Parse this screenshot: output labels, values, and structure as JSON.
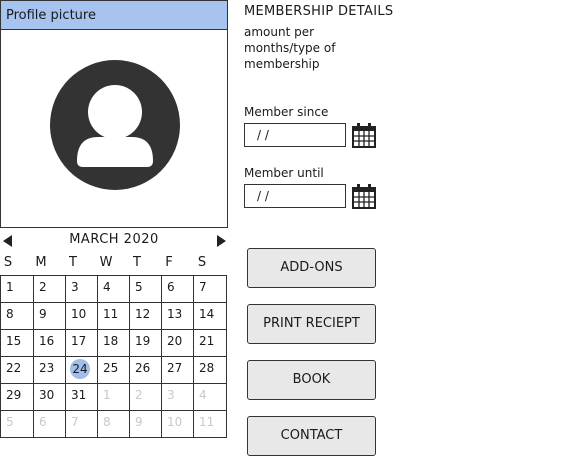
{
  "profile": {
    "title": "Profile picture"
  },
  "calendar": {
    "month_label": "MARCH 2020",
    "weekdays": [
      "S",
      "M",
      "T",
      "W",
      "T",
      "F",
      "S"
    ],
    "weeks": [
      [
        {
          "d": "1"
        },
        {
          "d": "2"
        },
        {
          "d": "3"
        },
        {
          "d": "4"
        },
        {
          "d": "5"
        },
        {
          "d": "6"
        },
        {
          "d": "7"
        }
      ],
      [
        {
          "d": "8"
        },
        {
          "d": "9"
        },
        {
          "d": "10"
        },
        {
          "d": "11"
        },
        {
          "d": "12"
        },
        {
          "d": "13"
        },
        {
          "d": "14"
        }
      ],
      [
        {
          "d": "15"
        },
        {
          "d": "16"
        },
        {
          "d": "17"
        },
        {
          "d": "18"
        },
        {
          "d": "19"
        },
        {
          "d": "20"
        },
        {
          "d": "21"
        }
      ],
      [
        {
          "d": "22"
        },
        {
          "d": "23"
        },
        {
          "d": "24",
          "today": true
        },
        {
          "d": "25"
        },
        {
          "d": "26"
        },
        {
          "d": "27"
        },
        {
          "d": "28"
        }
      ],
      [
        {
          "d": "29"
        },
        {
          "d": "30"
        },
        {
          "d": "31"
        },
        {
          "d": "1",
          "other": true
        },
        {
          "d": "2",
          "other": true
        },
        {
          "d": "3",
          "other": true
        },
        {
          "d": "4",
          "other": true
        }
      ],
      [
        {
          "d": "5",
          "other": true
        },
        {
          "d": "6",
          "other": true
        },
        {
          "d": "7",
          "other": true
        },
        {
          "d": "8",
          "other": true
        },
        {
          "d": "9",
          "other": true
        },
        {
          "d": "10",
          "other": true
        },
        {
          "d": "11",
          "other": true
        }
      ]
    ]
  },
  "membership": {
    "title": "MEMBERSHIP DETAILS",
    "description": "amount per months/type of membership",
    "since_label": "Member since",
    "since_value": " /  /",
    "until_label": "Member until",
    "until_value": " /  /"
  },
  "buttons": {
    "addons": "ADD-ONS",
    "print": "PRINT RECIEPT",
    "book": "BOOK",
    "contact": "CONTACT"
  },
  "colors": {
    "header_blue": "#a7c3f0",
    "today_highlight": "#9fbeea",
    "button_gray": "#e8e8e8"
  }
}
